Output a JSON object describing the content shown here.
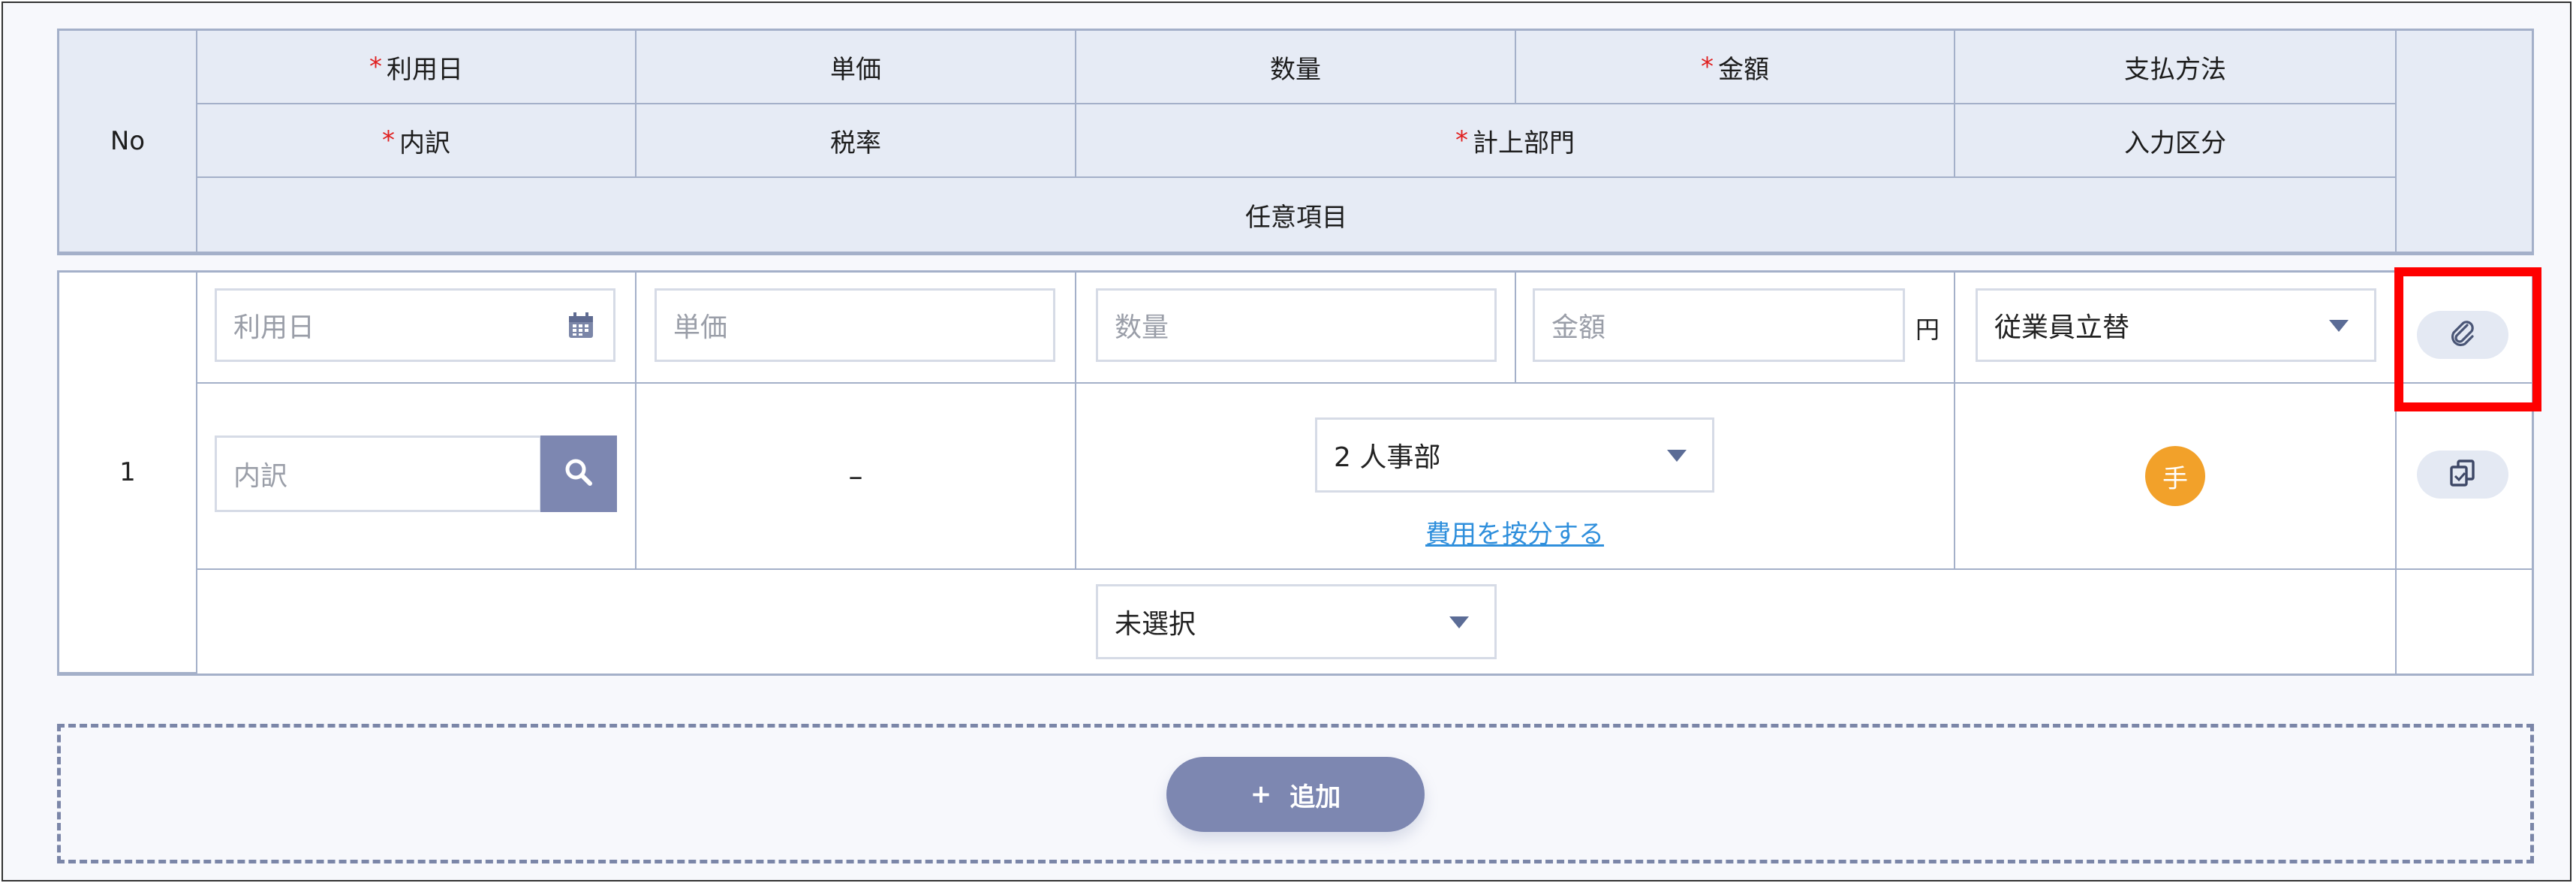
{
  "header": {
    "no": "No",
    "row1": {
      "riyoubi": "利用日",
      "tanka": "単価",
      "suuryou": "数量",
      "kingaku": "金額",
      "shiharai": "支払方法"
    },
    "row2": {
      "uchiwake": "内訳",
      "zeiritsu": "税率",
      "keijou": "計上部門",
      "nyuryoku": "入力区分"
    },
    "row3": {
      "nini": "任意項目"
    },
    "required_mark": "*"
  },
  "row": {
    "no": "1",
    "inputs": {
      "riyoubi_placeholder": "利用日",
      "tanka_placeholder": "単価",
      "suuryou_placeholder": "数量",
      "kingaku_placeholder": "金額",
      "kingaku_unit": "円",
      "uchiwake_placeholder": "内訳"
    },
    "shiharai_selected": "従業員立替",
    "zeiritsu_value": "–",
    "department_selected": "2 人事部",
    "allocate_link": "費用を按分する",
    "input_type_badge": "手",
    "optional_selected": "未選択"
  },
  "footer": {
    "add_label": "追加",
    "add_plus": "+"
  },
  "colors": {
    "header_bg": "#e6ebf5",
    "border": "#a4b0c9",
    "accent_button": "#7d87b1",
    "badge_orange": "#f2a12a",
    "link_blue": "#2f8fdc",
    "highlight_red": "#ff0000"
  },
  "icons": {
    "calendar": "calendar-icon",
    "search": "search-icon",
    "attach": "paperclip-icon",
    "copy": "copy-icon",
    "dropdown": "chevron-down-icon"
  }
}
